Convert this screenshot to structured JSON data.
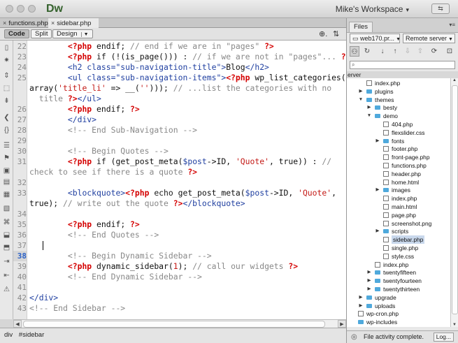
{
  "app": {
    "logo": "Dw",
    "workspace": "Mike's Workspace",
    "workspace_btn": "⇆"
  },
  "tabs": [
    {
      "label": "functions.php",
      "active": false
    },
    {
      "label": "sidebar.php",
      "active": true
    }
  ],
  "view": {
    "code": "Code",
    "split": "Split",
    "design": "Design"
  },
  "gutter_lines": [
    "22",
    "23",
    "24",
    "25",
    "",
    "",
    "26",
    "27",
    "28",
    "29",
    "30",
    "31",
    "",
    "32",
    "33",
    "",
    "34",
    "35",
    "36",
    "37",
    "38",
    "39",
    "40",
    "41",
    "42",
    "43"
  ],
  "current_line": "38",
  "status": {
    "tag": "div",
    "selector": "#sidebar"
  },
  "files_panel": {
    "tab": "Files",
    "site": "web170.pr...",
    "server": "Remote server",
    "search_placeholder": "",
    "section": "erver",
    "status_text": "File activity complete.",
    "log_label": "Log..."
  },
  "tree": [
    {
      "label": "index.php",
      "depth": 1,
      "type": "file",
      "arrow": ""
    },
    {
      "label": "plugins",
      "depth": 1,
      "type": "folder",
      "arrow": "▶"
    },
    {
      "label": "themes",
      "depth": 1,
      "type": "folder",
      "arrow": "▼"
    },
    {
      "label": "besty",
      "depth": 2,
      "type": "folder",
      "arrow": "▶"
    },
    {
      "label": "demo",
      "depth": 2,
      "type": "folder",
      "arrow": "▼"
    },
    {
      "label": "404.php",
      "depth": 3,
      "type": "file",
      "arrow": ""
    },
    {
      "label": "flexslider.css",
      "depth": 3,
      "type": "file",
      "arrow": ""
    },
    {
      "label": "fonts",
      "depth": 3,
      "type": "folder",
      "arrow": "▶"
    },
    {
      "label": "footer.php",
      "depth": 3,
      "type": "file",
      "arrow": ""
    },
    {
      "label": "front-page.php",
      "depth": 3,
      "type": "file",
      "arrow": ""
    },
    {
      "label": "functions.php",
      "depth": 3,
      "type": "file",
      "arrow": ""
    },
    {
      "label": "header.php",
      "depth": 3,
      "type": "file",
      "arrow": ""
    },
    {
      "label": "home.html",
      "depth": 3,
      "type": "file",
      "arrow": ""
    },
    {
      "label": "images",
      "depth": 3,
      "type": "folder",
      "arrow": "▶"
    },
    {
      "label": "index.php",
      "depth": 3,
      "type": "file",
      "arrow": ""
    },
    {
      "label": "main.html",
      "depth": 3,
      "type": "file",
      "arrow": ""
    },
    {
      "label": "page.php",
      "depth": 3,
      "type": "file",
      "arrow": ""
    },
    {
      "label": "screenshot.png",
      "depth": 3,
      "type": "file",
      "arrow": ""
    },
    {
      "label": "scripts",
      "depth": 3,
      "type": "folder",
      "arrow": "▶"
    },
    {
      "label": "sidebar.php",
      "depth": 3,
      "type": "file",
      "arrow": "",
      "selected": true
    },
    {
      "label": "single.php",
      "depth": 3,
      "type": "file",
      "arrow": ""
    },
    {
      "label": "style.css",
      "depth": 3,
      "type": "file",
      "arrow": ""
    },
    {
      "label": "index.php",
      "depth": 2,
      "type": "file",
      "arrow": ""
    },
    {
      "label": "twentyfifteen",
      "depth": 2,
      "type": "folder",
      "arrow": "▶"
    },
    {
      "label": "twentyfourteen",
      "depth": 2,
      "type": "folder",
      "arrow": "▶"
    },
    {
      "label": "twentythirteen",
      "depth": 2,
      "type": "folder",
      "arrow": "▶"
    },
    {
      "label": "upgrade",
      "depth": 1,
      "type": "folder",
      "arrow": "▶"
    },
    {
      "label": "uploads",
      "depth": 1,
      "type": "folder",
      "arrow": "▶"
    },
    {
      "label": "wp-cron.php",
      "depth": 0,
      "type": "file",
      "arrow": ""
    },
    {
      "label": "wp-includes",
      "depth": 0,
      "type": "folder",
      "arrow": ""
    }
  ],
  "code_lines": [
    [
      [
        "php",
        "<?php "
      ],
      [
        "fn",
        "endif"
      ],
      [
        "kw",
        "; "
      ],
      [
        "cm",
        "// end if we are in \"pages\" "
      ],
      [
        "php",
        "?>"
      ]
    ],
    [
      [
        "php",
        "<?php "
      ],
      [
        "kw",
        "if "
      ],
      [
        "fn",
        "(!(is_page()))"
      ],
      [
        "kw",
        " : "
      ],
      [
        "cm",
        "// if we are not in \"pages\"... "
      ],
      [
        "php",
        "?>"
      ]
    ],
    [
      [
        "tag",
        "<h2 class=\"sub-navigation-title\">"
      ],
      [
        "txt",
        "Blog"
      ],
      [
        "tag",
        "</h2>"
      ]
    ],
    [
      [
        "tag",
        "<ul class=\"sub-navigation-items\">"
      ],
      [
        "php",
        "<?php "
      ],
      [
        "fn",
        "wp_list_categories("
      ]
    ],
    [
      [
        "fn",
        "array("
      ],
      [
        "str",
        "'title_li'"
      ],
      [
        "fn",
        " => __("
      ],
      [
        "str",
        "''"
      ],
      [
        "fn",
        ")))"
      ],
      [
        "kw",
        "; "
      ],
      [
        "cm",
        "// ...list the categories with no"
      ]
    ],
    [
      [
        "cm",
        " title "
      ],
      [
        "php",
        "?>"
      ],
      [
        "tag",
        "</ul>"
      ]
    ],
    [
      [
        "php",
        "<?php "
      ],
      [
        "fn",
        "endif"
      ],
      [
        "kw",
        "; "
      ],
      [
        "php",
        "?>"
      ]
    ],
    [
      [
        "tag",
        "</div>"
      ]
    ],
    [
      [
        "cm",
        "<!-- End Sub-Navigation -->"
      ]
    ],
    [],
    [
      [
        "cm",
        "<!-- Begin Quotes -->"
      ]
    ],
    [
      [
        "php",
        "<?php "
      ],
      [
        "kw",
        "if "
      ],
      [
        "fn",
        "(get_post_meta("
      ],
      [
        "tag",
        "$post"
      ],
      [
        "fn",
        "->ID, "
      ],
      [
        "str",
        "'Quote'"
      ],
      [
        "fn",
        ", true)) : "
      ],
      [
        "cm",
        "//"
      ]
    ],
    [
      [
        "cm",
        "check to see if there is a quote "
      ],
      [
        "php",
        "?>"
      ]
    ],
    [],
    [
      [
        "tag",
        "<blockquote>"
      ],
      [
        "php",
        "<?php "
      ],
      [
        "kw",
        "echo "
      ],
      [
        "fn",
        "get_post_meta("
      ],
      [
        "tag",
        "$post"
      ],
      [
        "fn",
        "->ID, "
      ],
      [
        "str",
        "'Quote'"
      ],
      [
        "fn",
        ","
      ]
    ],
    [
      [
        "fn",
        "true)"
      ],
      [
        "kw",
        "; "
      ],
      [
        "cm",
        "// write out the quote "
      ],
      [
        "php",
        "?>"
      ],
      [
        "tag",
        "</blockquote>"
      ]
    ],
    [],
    [
      [
        "php",
        "<?php "
      ],
      [
        "fn",
        "endif"
      ],
      [
        "kw",
        "; "
      ],
      [
        "php",
        "?>"
      ]
    ],
    [
      [
        "cm",
        "<!-- End Quotes -->"
      ]
    ],
    [],
    [
      [
        "cm",
        "<!-- Begin Dynamic Sidebar -->"
      ]
    ],
    [
      [
        "php",
        "<?php "
      ],
      [
        "fn",
        "dynamic_sidebar("
      ],
      [
        "str",
        "1"
      ],
      [
        "fn",
        ")"
      ],
      [
        "kw",
        "; "
      ],
      [
        "cm",
        "// call our widgets "
      ],
      [
        "php",
        "?>"
      ]
    ],
    [
      [
        "cm",
        "<!-- End Dynamic Sidebar -->"
      ]
    ],
    [],
    [
      [
        "tag",
        "</div>"
      ]
    ],
    [
      [
        "cm",
        "<!-- End Sidebar -->"
      ]
    ]
  ],
  "code_indent": [
    8,
    8,
    8,
    8,
    0,
    1,
    8,
    8,
    8,
    0,
    8,
    8,
    0,
    0,
    8,
    0,
    0,
    8,
    8,
    0,
    8,
    8,
    8,
    0,
    0,
    0
  ]
}
